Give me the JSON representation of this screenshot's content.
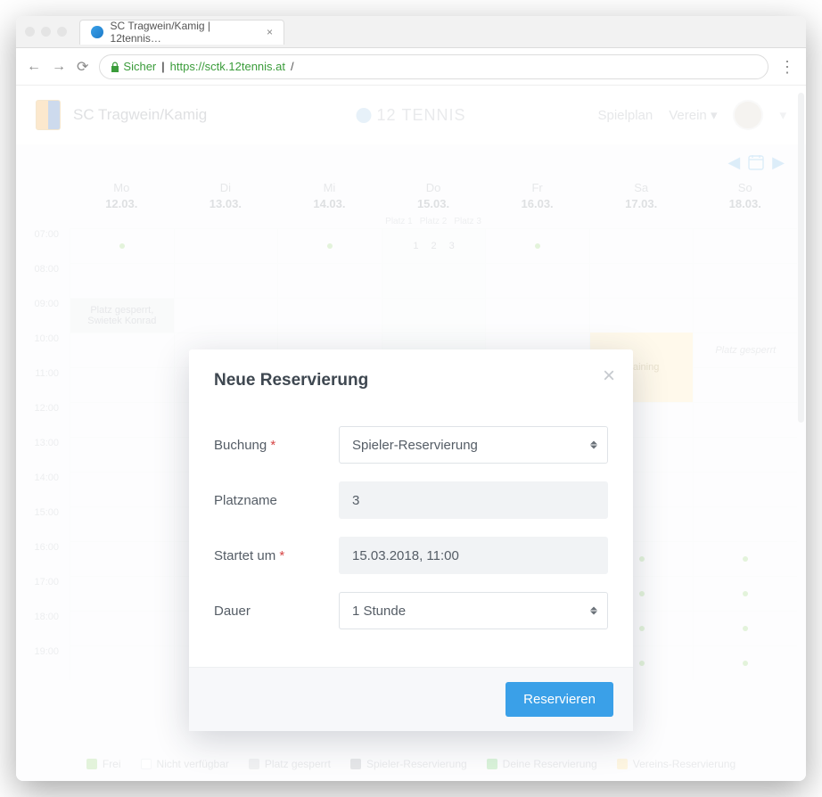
{
  "browser": {
    "tab_title": "SC Tragwein/Kamig | 12tennis…",
    "secure_label": "Sicher",
    "url_host": "https://sctk.12tennis.at",
    "url_path": "/"
  },
  "header": {
    "club_name": "SC Tragwein/Kamig",
    "brand_number": "12",
    "brand_word": "TENNIS",
    "nav": {
      "schedule": "Spielplan",
      "club": "Verein"
    }
  },
  "days": [
    {
      "dow": "Mo",
      "date": "12.03."
    },
    {
      "dow": "Di",
      "date": "13.03."
    },
    {
      "dow": "Mi",
      "date": "14.03."
    },
    {
      "dow": "Do",
      "date": "15.03."
    },
    {
      "dow": "Fr",
      "date": "16.03."
    },
    {
      "dow": "Sa",
      "date": "17.03."
    },
    {
      "dow": "So",
      "date": "18.03."
    }
  ],
  "courts": [
    "Platz 1",
    "Platz 2",
    "Platz 3"
  ],
  "court_nums": [
    "1",
    "2",
    "3"
  ],
  "hours": [
    "07:00",
    "08:00",
    "09:00",
    "10:00",
    "11:00",
    "12:00",
    "13:00",
    "14:00",
    "15:00",
    "16:00",
    "17:00",
    "18:00",
    "19:00"
  ],
  "events": {
    "mon_block": "Platz gesperrt, Swietek Konrad",
    "training": "Training",
    "sun_block": "Platz gesperrt"
  },
  "legend": {
    "free": "Frei",
    "unavailable": "Nicht verfügbar",
    "blocked": "Platz gesperrt",
    "player": "Spieler-Reservierung",
    "your": "Deine Reservierung",
    "club": "Vereins-Reservierung"
  },
  "modal": {
    "title": "Neue Reservierung",
    "labels": {
      "booking": "Buchung",
      "court": "Platzname",
      "start": "Startet um",
      "duration": "Dauer"
    },
    "values": {
      "booking": "Spieler-Reservierung",
      "court": "3",
      "start": "15.03.2018, 11:00",
      "duration": "1 Stunde"
    },
    "submit": "Reservieren"
  }
}
